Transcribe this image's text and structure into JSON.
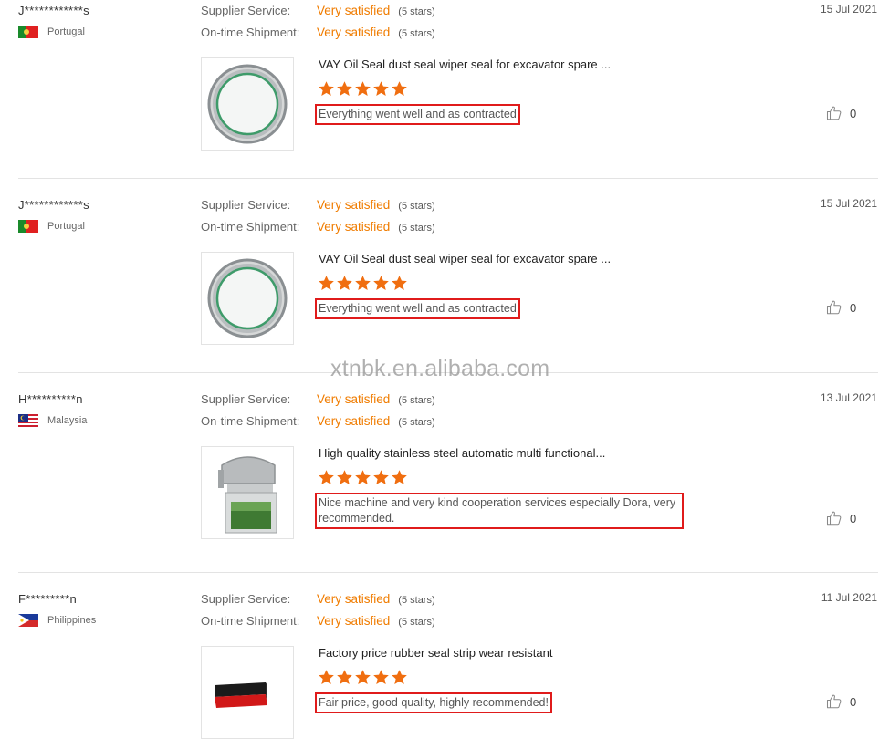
{
  "labels": {
    "supplier_service": "Supplier Service:",
    "on_time_shipment": "On-time Shipment:"
  },
  "reviews": [
    {
      "buyer": "J************s",
      "country": "Portugal",
      "flag": "portugal-flag-icon",
      "date": "15 Jul 2021",
      "supplier_service": "Very satisfied",
      "supplier_service_stars": "(5 stars)",
      "on_time_shipment": "Very satisfied",
      "on_time_shipment_stars": "(5 stars)",
      "product_title": "VAY Oil Seal dust seal wiper seal for excavator spare ...",
      "product_image": "oil-seal-ring-image",
      "rating": 5,
      "comment": "Everything went well and as contracted",
      "likes": "0"
    },
    {
      "buyer": "J************s",
      "country": "Portugal",
      "flag": "portugal-flag-icon",
      "date": "15 Jul 2021",
      "supplier_service": "Very satisfied",
      "supplier_service_stars": "(5 stars)",
      "on_time_shipment": "Very satisfied",
      "on_time_shipment_stars": "(5 stars)",
      "product_title": "VAY Oil Seal dust seal wiper seal for excavator spare ...",
      "product_image": "oil-seal-ring-image",
      "rating": 5,
      "comment": "Everything went well and as contracted",
      "likes": "0"
    },
    {
      "buyer": "H**********n",
      "country": "Malaysia",
      "flag": "malaysia-flag-icon",
      "date": "13 Jul 2021",
      "supplier_service": "Very satisfied",
      "supplier_service_stars": "(5 stars)",
      "on_time_shipment": "Very satisfied",
      "on_time_shipment_stars": "(5 stars)",
      "product_title": "High quality stainless steel automatic multi functional...",
      "product_image": "vegetable-cutter-machine-image",
      "rating": 5,
      "comment": "Nice machine and very kind cooperation services especially Dora, very recommended.",
      "likes": "0"
    },
    {
      "buyer": "F*********n",
      "country": "Philippines",
      "flag": "philippines-flag-icon",
      "date": "11 Jul 2021",
      "supplier_service": "Very satisfied",
      "supplier_service_stars": "(5 stars)",
      "on_time_shipment": "Very satisfied",
      "on_time_shipment_stars": "(5 stars)",
      "product_title": "Factory price rubber seal strip wear resistant",
      "product_image": "rubber-seal-strip-image",
      "rating": 5,
      "comment": "Fair price, good quality, highly recommended!",
      "likes": "0"
    }
  ],
  "watermark": "xtnbk.en.alibaba.com",
  "colors": {
    "accent": "#f07c00",
    "star": "#f06e10",
    "highlight_box": "#e01b1b"
  }
}
